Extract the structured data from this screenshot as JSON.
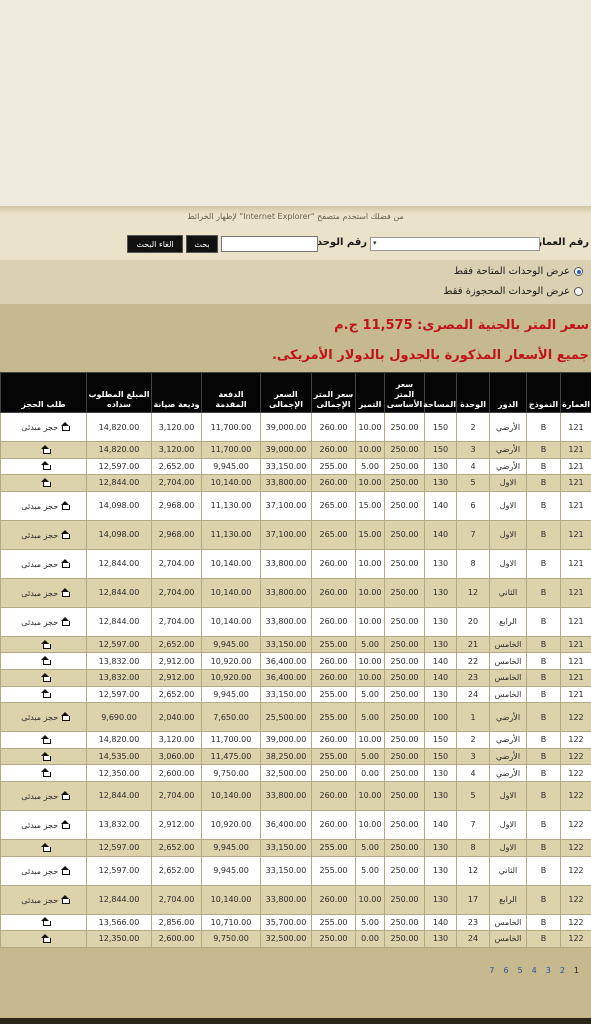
{
  "notice": "من فضلك استخدم متصفح \"Internet Explorer\" لإظهار الخرائط",
  "search": {
    "building_label": "رقم العمارة",
    "unit_label": "رقم الوحدة",
    "search_button": "بحث",
    "cancel_button": "الغاء البحث"
  },
  "filters": {
    "available": "عرض الوحدات المتاحة فقط",
    "reserved": "عرض الوحدات المحجوزة فقط",
    "selected": "available"
  },
  "price_note": "سعر المتر بالجنية المصرى: 11,575 ج.م",
  "usd_note": "جميع الأسعار المذكورة بالجدول بالدولار الأمريكى.",
  "table": {
    "headers": [
      "العمارة",
      "النموذج",
      "الدور",
      "الوحدة",
      "المساحة",
      "سعر المتر الأساسى",
      "التميز",
      "سعر المتر الإجمالى",
      "السعر الإجمالى",
      "الدفعة المقدمة",
      "وديعة صيانة",
      "المبلغ المطلوب سداده",
      "طلب الحجز"
    ],
    "booking_text": "حجز مبدئى",
    "rows": [
      {
        "b": "121",
        "m": "B",
        "f": "الأرضي",
        "u": "2",
        "a": "150",
        "bp": "250.00",
        "d": "10.00",
        "tp": "260.00",
        "total": "39,000.00",
        "down": "11,700.00",
        "dep": "3,120.00",
        "due": "14,820.00",
        "bk": "text"
      },
      {
        "b": "121",
        "m": "B",
        "f": "الأرضي",
        "u": "3",
        "a": "150",
        "bp": "250.00",
        "d": "10.00",
        "tp": "260.00",
        "total": "39,000.00",
        "down": "11,700.00",
        "dep": "3,120.00",
        "due": "14,820.00",
        "bk": "icon"
      },
      {
        "b": "121",
        "m": "B",
        "f": "الأرضي",
        "u": "4",
        "a": "130",
        "bp": "250.00",
        "d": "5.00",
        "tp": "255.00",
        "total": "33,150.00",
        "down": "9,945.00",
        "dep": "2,652.00",
        "due": "12,597.00",
        "bk": "icon"
      },
      {
        "b": "121",
        "m": "B",
        "f": "الاول",
        "u": "5",
        "a": "130",
        "bp": "250.00",
        "d": "10.00",
        "tp": "260.00",
        "total": "33,800.00",
        "down": "10,140.00",
        "dep": "2,704.00",
        "due": "12,844.00",
        "bk": "icon"
      },
      {
        "b": "121",
        "m": "B",
        "f": "الاول",
        "u": "6",
        "a": "140",
        "bp": "250.00",
        "d": "15.00",
        "tp": "265.00",
        "total": "37,100.00",
        "down": "11,130.00",
        "dep": "2,968.00",
        "due": "14,098.00",
        "bk": "text"
      },
      {
        "b": "121",
        "m": "B",
        "f": "الاول",
        "u": "7",
        "a": "140",
        "bp": "250.00",
        "d": "15.00",
        "tp": "265.00",
        "total": "37,100.00",
        "down": "11,130.00",
        "dep": "2,968.00",
        "due": "14,098.00",
        "bk": "text"
      },
      {
        "b": "121",
        "m": "B",
        "f": "الاول",
        "u": "8",
        "a": "130",
        "bp": "250.00",
        "d": "10.00",
        "tp": "260.00",
        "total": "33,800.00",
        "down": "10,140.00",
        "dep": "2,704.00",
        "due": "12,844.00",
        "bk": "text"
      },
      {
        "b": "121",
        "m": "B",
        "f": "الثاني",
        "u": "12",
        "a": "130",
        "bp": "250.00",
        "d": "10.00",
        "tp": "260.00",
        "total": "33,800.00",
        "down": "10,140.00",
        "dep": "2,704.00",
        "due": "12,844.00",
        "bk": "text"
      },
      {
        "b": "121",
        "m": "B",
        "f": "الرابع",
        "u": "20",
        "a": "130",
        "bp": "250.00",
        "d": "10.00",
        "tp": "260.00",
        "total": "33,800.00",
        "down": "10,140.00",
        "dep": "2,704.00",
        "due": "12,844.00",
        "bk": "text"
      },
      {
        "b": "121",
        "m": "B",
        "f": "الخامس",
        "u": "21",
        "a": "130",
        "bp": "250.00",
        "d": "5.00",
        "tp": "255.00",
        "total": "33,150.00",
        "down": "9,945.00",
        "dep": "2,652.00",
        "due": "12,597.00",
        "bk": "icon"
      },
      {
        "b": "121",
        "m": "B",
        "f": "الخامس",
        "u": "22",
        "a": "140",
        "bp": "250.00",
        "d": "10.00",
        "tp": "260.00",
        "total": "36,400.00",
        "down": "10,920.00",
        "dep": "2,912.00",
        "due": "13,832.00",
        "bk": "icon"
      },
      {
        "b": "121",
        "m": "B",
        "f": "الخامس",
        "u": "23",
        "a": "140",
        "bp": "250.00",
        "d": "10.00",
        "tp": "260.00",
        "total": "36,400.00",
        "down": "10,920.00",
        "dep": "2,912.00",
        "due": "13,832.00",
        "bk": "icon"
      },
      {
        "b": "121",
        "m": "B",
        "f": "الخامس",
        "u": "24",
        "a": "130",
        "bp": "250.00",
        "d": "5.00",
        "tp": "255.00",
        "total": "33,150.00",
        "down": "9,945.00",
        "dep": "2,652.00",
        "due": "12,597.00",
        "bk": "icon"
      },
      {
        "b": "122",
        "m": "B",
        "f": "الأرضي",
        "u": "1",
        "a": "100",
        "bp": "250.00",
        "d": "5.00",
        "tp": "255.00",
        "total": "25,500.00",
        "down": "7,650.00",
        "dep": "2,040.00",
        "due": "9,690.00",
        "bk": "text"
      },
      {
        "b": "122",
        "m": "B",
        "f": "الأرضي",
        "u": "2",
        "a": "150",
        "bp": "250.00",
        "d": "10.00",
        "tp": "260.00",
        "total": "39,000.00",
        "down": "11,700.00",
        "dep": "3,120.00",
        "due": "14,820.00",
        "bk": "icon"
      },
      {
        "b": "122",
        "m": "B",
        "f": "الأرضي",
        "u": "3",
        "a": "150",
        "bp": "250.00",
        "d": "5.00",
        "tp": "255.00",
        "total": "38,250.00",
        "down": "11,475.00",
        "dep": "3,060.00",
        "due": "14,535.00",
        "bk": "icon"
      },
      {
        "b": "122",
        "m": "B",
        "f": "الأرضي",
        "u": "4",
        "a": "130",
        "bp": "250.00",
        "d": "0.00",
        "tp": "250.00",
        "total": "32,500.00",
        "down": "9,750.00",
        "dep": "2,600.00",
        "due": "12,350.00",
        "bk": "icon"
      },
      {
        "b": "122",
        "m": "B",
        "f": "الاول",
        "u": "5",
        "a": "130",
        "bp": "250.00",
        "d": "10.00",
        "tp": "260.00",
        "total": "33,800.00",
        "down": "10,140.00",
        "dep": "2,704.00",
        "due": "12,844.00",
        "bk": "text"
      },
      {
        "b": "122",
        "m": "B",
        "f": "الاول",
        "u": "7",
        "a": "140",
        "bp": "250.00",
        "d": "10.00",
        "tp": "260.00",
        "total": "36,400.00",
        "down": "10,920.00",
        "dep": "2,912.00",
        "due": "13,832.00",
        "bk": "text"
      },
      {
        "b": "122",
        "m": "B",
        "f": "الاول",
        "u": "8",
        "a": "130",
        "bp": "250.00",
        "d": "5.00",
        "tp": "255.00",
        "total": "33,150.00",
        "down": "9,945.00",
        "dep": "2,652.00",
        "due": "12,597.00",
        "bk": "icon"
      },
      {
        "b": "122",
        "m": "B",
        "f": "الثاني",
        "u": "12",
        "a": "130",
        "bp": "250.00",
        "d": "5.00",
        "tp": "255.00",
        "total": "33,150.00",
        "down": "9,945.00",
        "dep": "2,652.00",
        "due": "12,597.00",
        "bk": "text"
      },
      {
        "b": "122",
        "m": "B",
        "f": "الرابع",
        "u": "17",
        "a": "130",
        "bp": "250.00",
        "d": "10.00",
        "tp": "260.00",
        "total": "33,800.00",
        "down": "10,140.00",
        "dep": "2,704.00",
        "due": "12,844.00",
        "bk": "text"
      },
      {
        "b": "122",
        "m": "B",
        "f": "الخامس",
        "u": "23",
        "a": "140",
        "bp": "250.00",
        "d": "5.00",
        "tp": "255.00",
        "total": "35,700.00",
        "down": "10,710.00",
        "dep": "2,856.00",
        "due": "13,566.00",
        "bk": "icon"
      },
      {
        "b": "122",
        "m": "B",
        "f": "الخامس",
        "u": "24",
        "a": "130",
        "bp": "250.00",
        "d": "0.00",
        "tp": "250.00",
        "total": "32,500.00",
        "down": "9,750.00",
        "dep": "2,600.00",
        "due": "12,350.00",
        "bk": "icon"
      }
    ]
  },
  "pagination": [
    "1",
    "2",
    "3",
    "4",
    "5",
    "6",
    "7"
  ],
  "colors": {
    "header_bg": "#050505",
    "price_red": "#c0141c",
    "band": "#c6b98d",
    "row_alt": "#dcd2ac"
  }
}
